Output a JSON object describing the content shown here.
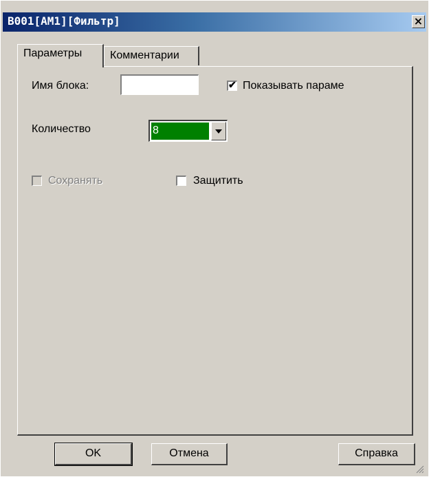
{
  "window": {
    "title": "B001[AM1][Фильтр]",
    "close_glyph": "×"
  },
  "tabs": [
    {
      "label": "Параметры",
      "active": true
    },
    {
      "label": "Комментарии",
      "active": false
    }
  ],
  "fields": {
    "block_name_label": "Имя блока:",
    "block_name_value": "",
    "show_params_label": "Показывать параме",
    "show_params_checked": true,
    "count_label": "Количество",
    "count_value": "8",
    "save_label": "Сохранять",
    "save_checked": false,
    "save_enabled": false,
    "protect_label": "Защитить",
    "protect_checked": false
  },
  "buttons": {
    "ok": "OK",
    "cancel": "Отмена",
    "help": "Справка"
  },
  "colors": {
    "combo_highlight": "#008000",
    "title_gradient_start": "#0a246a"
  }
}
